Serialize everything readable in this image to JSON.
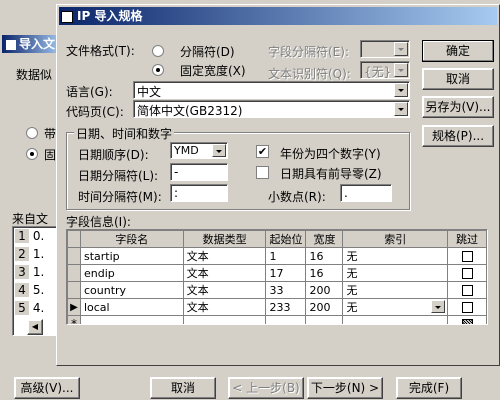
{
  "bg_window": {
    "title": "导入文",
    "label_data": "数据似",
    "radio_a": "带",
    "radio_b": "固",
    "label_source": "来自文",
    "rows": [
      {
        "n": "1",
        "v": "0."
      },
      {
        "n": "2",
        "v": "1."
      },
      {
        "n": "3",
        "v": "1."
      },
      {
        "n": "4",
        "v": "5."
      },
      {
        "n": "5",
        "v": "4."
      }
    ],
    "advanced": "高级(V)...",
    "cancel": "取消",
    "back": "< 上一步(B)",
    "next": "下一步(N) >",
    "finish": "完成(F)"
  },
  "dialog": {
    "title": "IP 导入规格",
    "file_format_label": "文件格式(T):",
    "delimited": "分隔符(D)",
    "fixed_width": "固定宽度(X)",
    "field_delim_label": "字段分隔符(E):",
    "text_qualifier_label": "文本识别符(Q):",
    "text_qualifier_value": "{无}",
    "language_label": "语言(G):",
    "language_value": "中文",
    "codepage_label": "代码页(C):",
    "codepage_value": "简体中文(GB2312)",
    "datetime_group": "日期、时间和数字",
    "date_order_label": "日期顺序(D):",
    "date_order_value": "YMD",
    "four_digit_year": "年份为四个数字(Y)",
    "date_sep_label": "日期分隔符(L):",
    "date_sep_value": "-",
    "leading_zeros": "日期具有前导零(Z)",
    "time_sep_label": "时间分隔符(M):",
    "time_sep_value": ":",
    "decimal_label": "小数点(R):",
    "decimal_value": ".",
    "field_info_label": "字段信息(I):",
    "ok": "确定",
    "cancel": "取消",
    "save_as": "另存为(V)...",
    "specs": "规格(P)...",
    "columns": [
      "字段名",
      "数据类型",
      "起始位",
      "宽度",
      "索引",
      "跳过"
    ],
    "fields": [
      {
        "name": "startip",
        "type": "文本",
        "start": "1",
        "width": "16",
        "index": "无"
      },
      {
        "name": "endip",
        "type": "文本",
        "start": "17",
        "width": "16",
        "index": "无"
      },
      {
        "name": "country",
        "type": "文本",
        "start": "33",
        "width": "200",
        "index": "无"
      },
      {
        "name": "local",
        "type": "文本",
        "start": "233",
        "width": "200",
        "index": "无"
      }
    ],
    "new_row_marker": "*"
  }
}
